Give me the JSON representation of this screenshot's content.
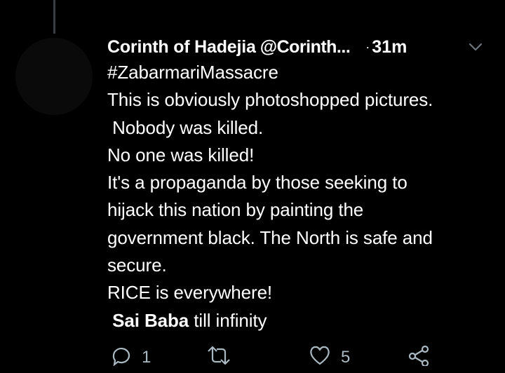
{
  "tweet": {
    "display_name": "Corinth of Hadejia",
    "handle": "@Corinth...",
    "separator": "·",
    "time": "31m",
    "hashtag": "#ZabarmariMassacre",
    "lines": [
      "This is obviously photoshopped pictures.",
      " Nobody was killed.",
      "No one was killed!",
      "It's a propaganda by those seeking to",
      "hijack this nation by painting the",
      "government black. The North is safe and",
      "secure.",
      "RICE is everywhere!"
    ],
    "last_line_bold": "Sai Baba",
    "last_line_rest": " till infinity"
  },
  "actions": {
    "reply_count": "1",
    "like_count": "5"
  },
  "icons": {
    "menu": "chevron-down-icon",
    "reply": "reply-icon",
    "retweet": "retweet-icon",
    "like": "heart-icon",
    "share": "share-icon"
  },
  "colors": {
    "background": "#000000",
    "text": "#ffffff",
    "muted": "#6e767d",
    "thread_line": "#3a3f44"
  }
}
